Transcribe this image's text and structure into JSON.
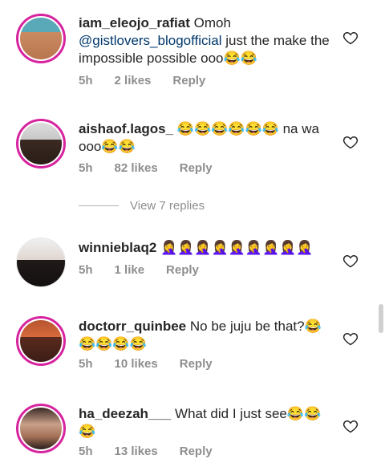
{
  "comments": [
    {
      "username": "iam_eleojo_rafiat",
      "text_pre": "Omoh",
      "mention": "@gistlovers_blogofficial",
      "text_post": "just the make the impossible possible ooo😂😂",
      "time": "5h",
      "likes": "2 likes",
      "reply": "Reply",
      "avatar_icon": "person-avatar"
    },
    {
      "username": "aishaof.lagos_",
      "text": "😂😂😂😂😂😂 na wa ooo😂😂",
      "time": "5h",
      "likes": "82 likes",
      "reply": "Reply",
      "avatar_icon": "person-avatar"
    },
    {
      "username": "winnieblaq2",
      "text": "🤦‍♀️🤦‍♀️🤦‍♀️🤦‍♀️🤦‍♀️🤦‍♀️🤦‍♀️🤦‍♀️🤦‍♀️",
      "time": "5h",
      "likes": "1 like",
      "reply": "Reply",
      "avatar_icon": "person-avatar"
    },
    {
      "username": "doctorr_quinbee",
      "text": "No be juju be that?😂😂😂😂😂",
      "time": "5h",
      "likes": "10 likes",
      "reply": "Reply",
      "avatar_icon": "person-avatar"
    },
    {
      "username": "ha_deezah___",
      "text": "What did I just see😂😂😂",
      "time": "5h",
      "likes": "13 likes",
      "reply": "Reply",
      "avatar_icon": "person-avatar"
    }
  ],
  "view_replies": "View 7 replies",
  "colors": {
    "ring": "#d6249f",
    "meta": "#8e8e8e",
    "mention": "#00376b"
  },
  "icons": {
    "like": "heart-outline-icon"
  }
}
